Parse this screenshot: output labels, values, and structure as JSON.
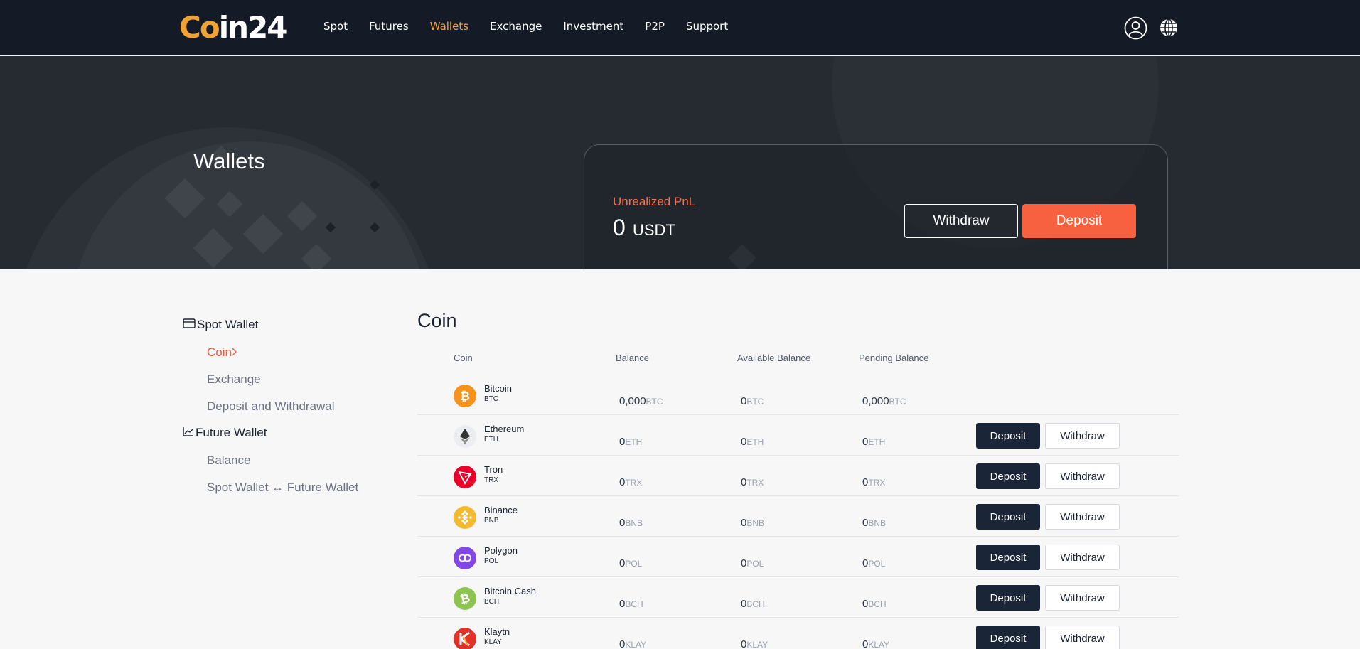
{
  "brand": {
    "logo_c": "C",
    "logo_o": "o",
    "logo_rest": "in24",
    "accent": "#f5a142",
    "cta": "#f7613f"
  },
  "nav": {
    "links": [
      "Spot",
      "Futures",
      "Wallets",
      "Exchange",
      "Investment",
      "P2P",
      "Support"
    ],
    "active": "Wallets",
    "icons": [
      "user-icon",
      "globe-icon"
    ]
  },
  "hero": {
    "title": "Wallets",
    "pnl_label": "Unrealized PnL",
    "pnl_value": "0",
    "pnl_unit": "USDT",
    "withdraw_label": "Withdraw",
    "deposit_label": "Deposit"
  },
  "sidebar": {
    "spot_wallet": "Spot Wallet",
    "spot_items": [
      "Coin",
      "Exchange",
      "Deposit and Withdrawal"
    ],
    "future_wallet": "Future Wallet",
    "future_items": [
      "Balance",
      "Spot Wallet ↔ Future Wallet"
    ]
  },
  "main": {
    "title": "Coin",
    "columns": [
      "Coin",
      "Balance",
      "Available Balance",
      "Pending Balance"
    ],
    "deposit_label": "Deposit",
    "withdraw_label": "Withdraw",
    "rows": [
      {
        "name": "Bitcoin",
        "sym": "BTC",
        "balance": "0,000",
        "available": "0",
        "pending": "0,000",
        "color": "#f7931a",
        "actions": false
      },
      {
        "name": "Ethereum",
        "sym": "ETH",
        "balance": "0",
        "available": "0",
        "pending": "0",
        "color": "#ecedf0",
        "actions": true
      },
      {
        "name": "Tron",
        "sym": "TRX",
        "balance": "0",
        "available": "0",
        "pending": "0",
        "color": "#eb0029",
        "actions": true
      },
      {
        "name": "Binance",
        "sym": "BNB",
        "balance": "0",
        "available": "0",
        "pending": "0",
        "color": "#f3ba2f",
        "actions": true
      },
      {
        "name": "Polygon",
        "sym": "POL",
        "balance": "0",
        "available": "0",
        "pending": "0",
        "color": "#8247e5",
        "actions": true
      },
      {
        "name": "Bitcoin Cash",
        "sym": "BCH",
        "balance": "0",
        "available": "0",
        "pending": "0",
        "color": "#8dc351",
        "actions": true
      },
      {
        "name": "Klaytn",
        "sym": "KLAY",
        "balance": "0",
        "available": "0",
        "pending": "0",
        "color": "#e0312b",
        "actions": true
      }
    ]
  }
}
